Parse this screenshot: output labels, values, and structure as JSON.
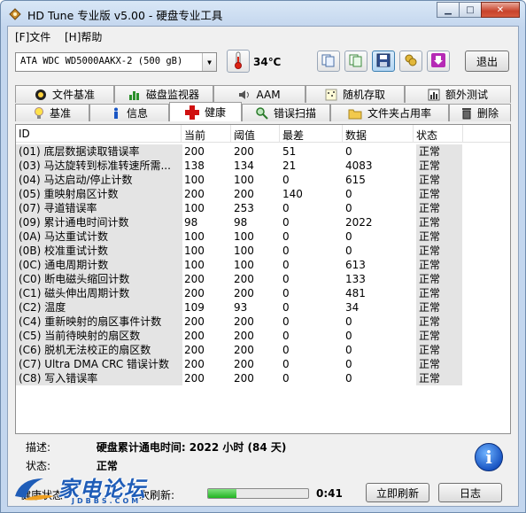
{
  "window": {
    "title": "HD Tune 专业版 v5.00 - 硬盘专业工具"
  },
  "menu": {
    "file": "[F]文件",
    "help": "[H]帮助"
  },
  "toolbar": {
    "drive": "ATA    WDC WD5000AAKX-2 (500 gB)",
    "temperature": "34℃",
    "exit_label": "退出"
  },
  "tabs_top": [
    "文件基准",
    "磁盘监视器",
    "AAM",
    "随机存取",
    "额外测试"
  ],
  "tabs_bottom": [
    "基准",
    "信息",
    "健康",
    "错误扫描",
    "文件夹占用率",
    "删除"
  ],
  "table": {
    "headers": [
      "ID",
      "当前",
      "阈值",
      "最差",
      "数据",
      "状态"
    ],
    "rows": [
      {
        "id": "(01) 底层数据读取错误率",
        "cur": "200",
        "thr": "200",
        "worst": "51",
        "data": "0",
        "status": "正常"
      },
      {
        "id": "(03) 马达旋转到标准转速所需...",
        "cur": "138",
        "thr": "134",
        "worst": "21",
        "data": "4083",
        "status": "正常"
      },
      {
        "id": "(04) 马达启动/停止计数",
        "cur": "100",
        "thr": "100",
        "worst": "0",
        "data": "615",
        "status": "正常"
      },
      {
        "id": "(05) 重映射扇区计数",
        "cur": "200",
        "thr": "200",
        "worst": "140",
        "data": "0",
        "status": "正常"
      },
      {
        "id": "(07) 寻道错误率",
        "cur": "100",
        "thr": "253",
        "worst": "0",
        "data": "0",
        "status": "正常"
      },
      {
        "id": "(09) 累计通电时间计数",
        "cur": "98",
        "thr": "98",
        "worst": "0",
        "data": "2022",
        "status": "正常"
      },
      {
        "id": "(0A) 马达重试计数",
        "cur": "100",
        "thr": "100",
        "worst": "0",
        "data": "0",
        "status": "正常"
      },
      {
        "id": "(0B) 校准重试计数",
        "cur": "100",
        "thr": "100",
        "worst": "0",
        "data": "0",
        "status": "正常"
      },
      {
        "id": "(0C) 通电周期计数",
        "cur": "100",
        "thr": "100",
        "worst": "0",
        "data": "613",
        "status": "正常"
      },
      {
        "id": "(C0) 断电磁头缩回计数",
        "cur": "200",
        "thr": "200",
        "worst": "0",
        "data": "133",
        "status": "正常"
      },
      {
        "id": "(C1) 磁头伸出周期计数",
        "cur": "200",
        "thr": "200",
        "worst": "0",
        "data": "481",
        "status": "正常"
      },
      {
        "id": "(C2) 温度",
        "cur": "109",
        "thr": "93",
        "worst": "0",
        "data": "34",
        "status": "正常"
      },
      {
        "id": "(C4) 重新映射的扇区事件计数",
        "cur": "200",
        "thr": "200",
        "worst": "0",
        "data": "0",
        "status": "正常"
      },
      {
        "id": "(C5) 当前待映射的扇区数",
        "cur": "200",
        "thr": "200",
        "worst": "0",
        "data": "0",
        "status": "正常"
      },
      {
        "id": "(C6) 脱机无法校正的扇区数",
        "cur": "200",
        "thr": "200",
        "worst": "0",
        "data": "0",
        "status": "正常"
      },
      {
        "id": "(C7) Ultra DMA CRC 错误计数",
        "cur": "200",
        "thr": "200",
        "worst": "0",
        "data": "0",
        "status": "正常"
      },
      {
        "id": "(C8) 写入错误率",
        "cur": "200",
        "thr": "200",
        "worst": "0",
        "data": "0",
        "status": "正常"
      }
    ]
  },
  "description": {
    "desc_label": "描述:",
    "desc_value": "硬盘累计通电时间: 2022 小时 (84 天)",
    "status_label": "状态:",
    "status_value": "正常"
  },
  "statusbar": {
    "health_label": "健康状态",
    "refresh_label": "次刷新:",
    "progress": 0.28,
    "time_left": "0:41",
    "refresh_now": "立即刷新",
    "log": "日志"
  },
  "watermark": {
    "text": "家电论坛",
    "sub": "JDBBS.COM"
  }
}
